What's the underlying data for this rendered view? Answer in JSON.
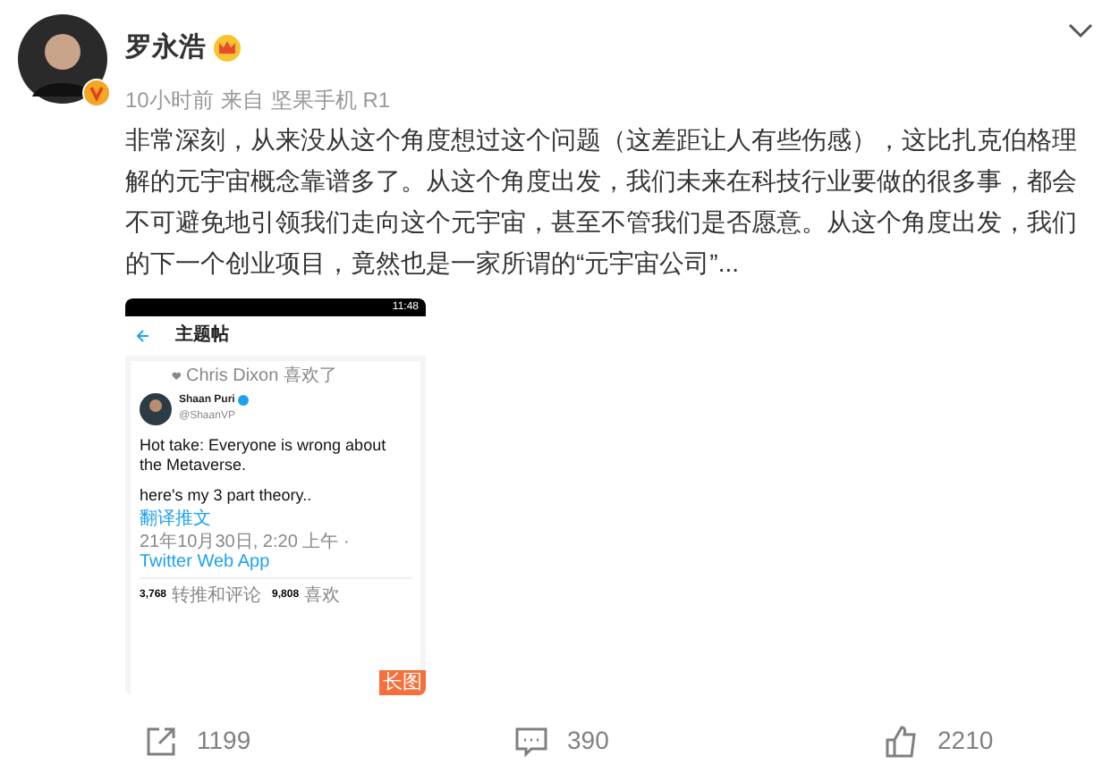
{
  "author": {
    "name": "罗永浩",
    "verified": true,
    "crown": true
  },
  "meta": {
    "time": "10小时前",
    "source_prefix": "来自",
    "source": "坚果手机 R1"
  },
  "text": "非常深刻，从来没从这个角度想过这个问题（这差距让人有些伤感），这比扎克伯格理解的元宇宙概念靠谱多了。从这个角度出发，我们未来在科技行业要做的很多事，都会不可避免地引领我们走向这个元宇宙，甚至不管我们是否愿意。从这个角度出发，我们的下一个创业项目，竟然也是一家所谓的“元宇宙公司”...",
  "attached_screenshot": {
    "status_time": "11:48",
    "header_title": "主题帖",
    "liked_by": "Chris Dixon 喜欢了",
    "tweet": {
      "author": "Shaan Puri",
      "handle": "@ShaanVP",
      "verified": true,
      "paragraphs": [
        "Hot take: Everyone is wrong about the Metaverse.",
        "here's my 3 part theory.."
      ],
      "translate": "翻译推文",
      "timestamp": "21年10月30日, 2:20 上午 · ",
      "client": "Twitter Web App",
      "retweets_count": "3,768",
      "retweets_label": "转推和评论",
      "likes_count": "9,808",
      "likes_label": "喜欢"
    },
    "badge": "长图"
  },
  "actions": [
    {
      "kind": "repost",
      "count": "1199"
    },
    {
      "kind": "comment",
      "count": "390"
    },
    {
      "kind": "like",
      "count": "2210"
    }
  ]
}
